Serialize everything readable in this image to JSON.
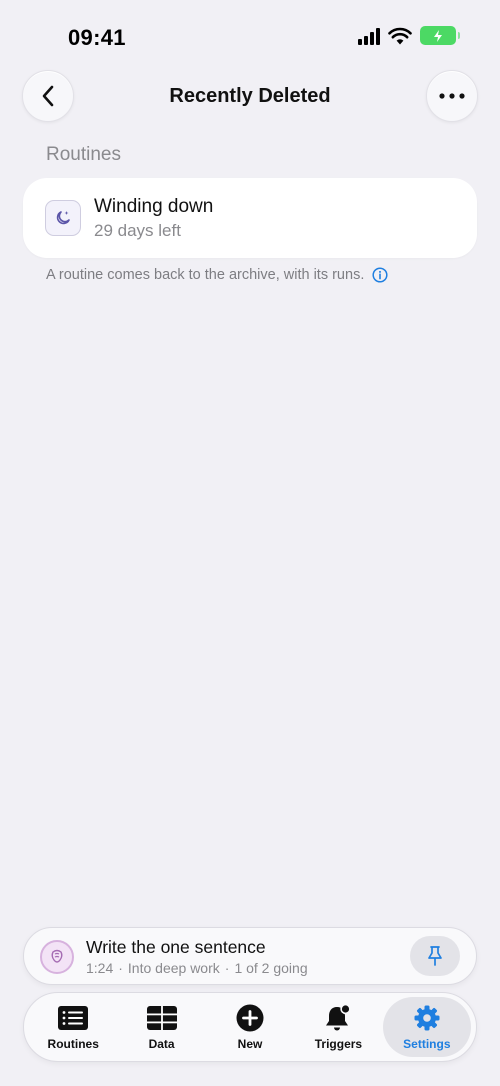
{
  "status_bar": {
    "time": "09:41"
  },
  "nav": {
    "title": "Recently Deleted"
  },
  "section": {
    "header": "Routines"
  },
  "items": [
    {
      "title": "Winding down",
      "subtitle": "29 days left",
      "icon": "moon-sparkle-icon"
    }
  ],
  "footnote": {
    "text": "A routine comes back to the archive, with its runs."
  },
  "mini_player": {
    "title": "Write the one sentence",
    "elapsed": "1:24",
    "stage": "Into deep work",
    "progress": "1 of 2 going"
  },
  "tabs": [
    {
      "label": "Routines",
      "icon": "list-icon",
      "active": false
    },
    {
      "label": "Data",
      "icon": "table-icon",
      "active": false
    },
    {
      "label": "New",
      "icon": "plus-circle-icon",
      "active": false
    },
    {
      "label": "Triggers",
      "icon": "bell-badge-icon",
      "active": false
    },
    {
      "label": "Settings",
      "icon": "gear-icon",
      "active": true
    }
  ],
  "colors": {
    "accent": "#1f7fe0",
    "background": "#f1f0f5",
    "battery": "#4cd964"
  }
}
